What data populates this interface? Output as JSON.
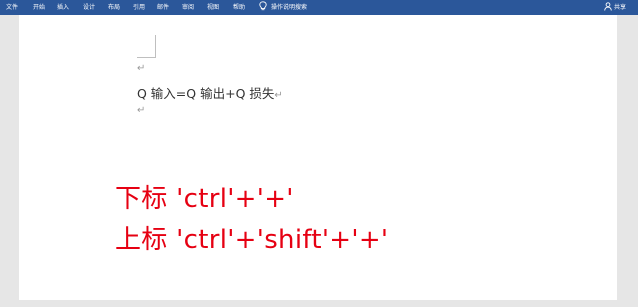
{
  "ribbon": {
    "tabs": [
      "文件",
      "开始",
      "插入",
      "设计",
      "布局",
      "引用",
      "邮件",
      "审阅",
      "视图",
      "帮助"
    ],
    "tell_me": "操作说明搜索",
    "share": "共享",
    "icons": {
      "tell_me": "lightbulb-icon",
      "share": "person-icon"
    }
  },
  "document": {
    "paragraph_mark": "↵",
    "equation_text": "Q 输入=Q 输出+Q 损失",
    "notes": [
      "下标 'ctrl'+'+'",
      "上标 'ctrl'+'shift'+'+'"
    ]
  },
  "colors": {
    "ribbon": "#2b579a",
    "note_text": "#e60012"
  }
}
